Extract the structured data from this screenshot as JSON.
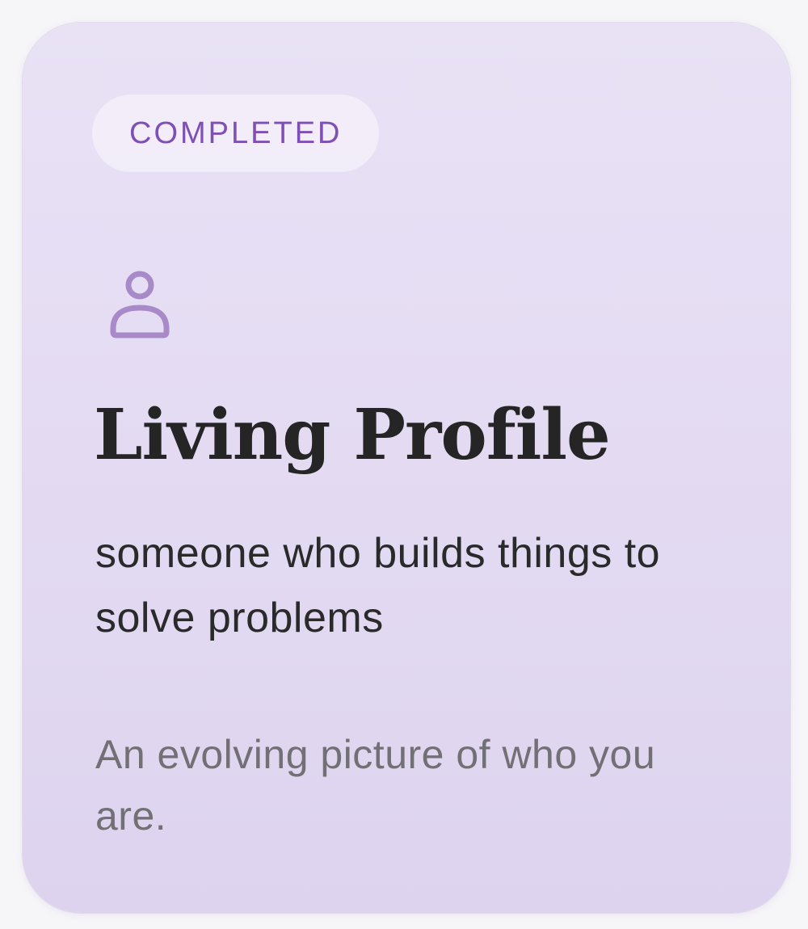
{
  "card": {
    "status_label": "COMPLETED",
    "icon": "person-icon",
    "title": "Living Profile",
    "subtitle": "someone who builds things to solve problems",
    "description": "An evolving picture of who you are."
  },
  "colors": {
    "card_background": "#e5dcf3",
    "badge_text": "#7e4fb5",
    "icon_stroke": "#a98ac9",
    "title_text": "#252525",
    "subtitle_text": "#2a2a2a",
    "description_text": "#727074"
  }
}
